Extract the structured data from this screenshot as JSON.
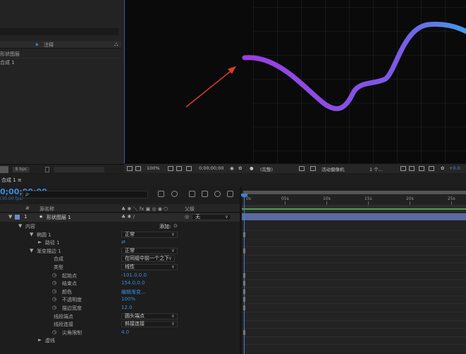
{
  "project": {
    "sort_label": "▲",
    "column_label": "注释",
    "item1": "形状图层",
    "item2": "合成 1"
  },
  "project_footer": {
    "bpc": "8 bpc"
  },
  "viewer_bar": {
    "zoom": "100%",
    "time": "0;00;00;00",
    "resolution": "(完整)",
    "camera": "活动摄像机",
    "views": "1 个...",
    "exposure": "+0.0"
  },
  "timeline": {
    "tab": "合成 1 ≡",
    "timecode": "0;00;00;00",
    "fps": "(30.00 fps)",
    "search_glyph": "ρ·",
    "columns": {
      "hash": "#",
      "source": "源名称",
      "switches": "♣ ✱ ＼ fx ▣ ◎ ◉ ⬡",
      "parent": "父级"
    },
    "ruler": [
      "0s",
      "05s",
      "10s",
      "15s",
      "20s",
      "25s"
    ],
    "layer": {
      "number": "1",
      "star": "★",
      "name": "形状图层 1",
      "switches": "♣ ✱ /",
      "parent_icon": "◎",
      "parent": "无"
    },
    "rows": [
      {
        "label": "内容",
        "value": "添加:",
        "type": "add"
      },
      {
        "label": "椭圆 1",
        "value": "正常",
        "type": "drop"
      },
      {
        "label": "路径 1",
        "value": "⇄",
        "type": "icon"
      },
      {
        "label": "渐变描边 1",
        "value": "正常",
        "type": "drop"
      },
      {
        "label": "合成",
        "value": "在同组中前一个之下",
        "type": "drop"
      },
      {
        "label": "类型",
        "value": "线性",
        "type": "drop"
      },
      {
        "label": "起始点",
        "value": "-101.0,0.0",
        "type": "num"
      },
      {
        "label": "结束点",
        "value": "154.0,0.0",
        "type": "num"
      },
      {
        "label": "颜色",
        "value": "编辑渐变...",
        "type": "num"
      },
      {
        "label": "不透明度",
        "value": "100%",
        "type": "num"
      },
      {
        "label": "描边宽度",
        "value": "12.0",
        "type": "num"
      },
      {
        "label": "线段端点",
        "value": "圆头端点",
        "type": "drop"
      },
      {
        "label": "线段连接",
        "value": "斜接连接",
        "type": "drop"
      },
      {
        "label": "尖角限制",
        "value": "4.0",
        "type": "num"
      },
      {
        "label": "虚线",
        "value": "",
        "type": "none"
      }
    ]
  },
  "colors": {
    "accent": "#3f8ad9",
    "curve_start": "#9b3fe0",
    "curve_end": "#3f9be8",
    "arrow": "#e03a2a"
  }
}
